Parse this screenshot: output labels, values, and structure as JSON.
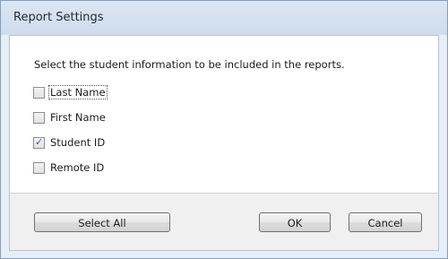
{
  "window": {
    "title": "Report Settings"
  },
  "dialog": {
    "instruction": "Select the student information to be included in the reports.",
    "options": [
      {
        "label": "Last Name",
        "checked": false,
        "focused": true
      },
      {
        "label": "First Name",
        "checked": false,
        "focused": false
      },
      {
        "label": "Student ID",
        "checked": true,
        "focused": false
      },
      {
        "label": "Remote ID",
        "checked": false,
        "focused": false
      }
    ]
  },
  "buttons": {
    "select_all": "Select All",
    "ok": "OK",
    "cancel": "Cancel"
  },
  "icons": {
    "check_mark": "✓"
  }
}
